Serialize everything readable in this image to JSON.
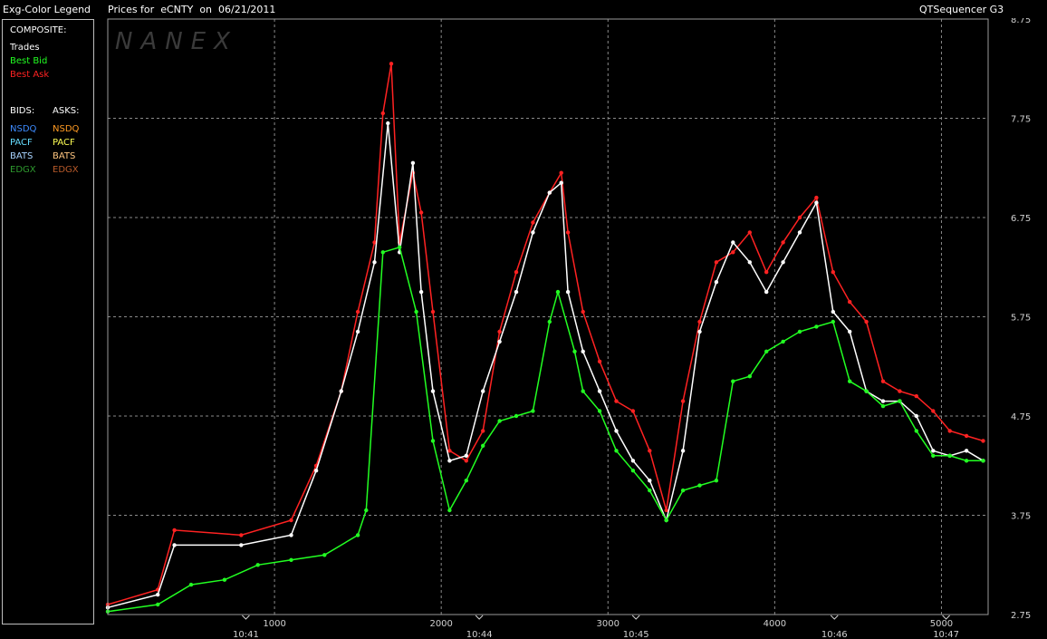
{
  "header": {
    "legend_title": "Exg-Color Legend",
    "chart_title_prefix": "Prices for",
    "symbol": "eCNTY",
    "date_prefix": "on",
    "date": "06/21/2011",
    "app_name": "QTSequencer G3"
  },
  "legend": {
    "composite_heading": "COMPOSITE:",
    "composite_items": [
      {
        "label": "Trades",
        "color": "#ffffff"
      },
      {
        "label": "Best Bid",
        "color": "#22ff22"
      },
      {
        "label": "Best Ask",
        "color": "#ff2222"
      }
    ],
    "bids_heading": "BIDS:",
    "asks_heading": "ASKS:",
    "bids": [
      {
        "label": "NSDQ",
        "color": "#3d8bff"
      },
      {
        "label": "PACF",
        "color": "#66ddff"
      },
      {
        "label": "BATS",
        "color": "#a9d4ff"
      },
      {
        "label": "EDGX",
        "color": "#2e9a2e"
      }
    ],
    "asks": [
      {
        "label": "NSDQ",
        "color": "#ff9a22"
      },
      {
        "label": "PACF",
        "color": "#ffff55"
      },
      {
        "label": "BATS",
        "color": "#ffc680"
      },
      {
        "label": "EDGX",
        "color": "#b85a2a"
      }
    ]
  },
  "watermark": "NANEX",
  "chart_data": {
    "type": "line",
    "y_ticks": [
      "8.75",
      "7.75",
      "6.75",
      "5.75",
      "4.75",
      "3.75",
      "2.75"
    ],
    "ylim": [
      2.75,
      8.75
    ],
    "xlim": [
      0,
      5280
    ],
    "x_seq_ticks": [
      {
        "x": 1000,
        "label": "1000"
      },
      {
        "x": 2000,
        "label": "2000"
      },
      {
        "x": 3000,
        "label": "3000"
      },
      {
        "x": 4000,
        "label": "4000"
      },
      {
        "x": 5000,
        "label": "5000"
      }
    ],
    "x_time_ticks": [
      {
        "x": 828,
        "label": "10:41"
      },
      {
        "x": 2228,
        "label": "10:44"
      },
      {
        "x": 3168,
        "label": "10:45"
      },
      {
        "x": 4358,
        "label": "10:46"
      },
      {
        "x": 5028,
        "label": "10:47"
      }
    ],
    "grid": true,
    "series": [
      {
        "name": "Best Ask",
        "color": "#ff2222",
        "points": [
          [
            0,
            2.85
          ],
          [
            300,
            3.0
          ],
          [
            400,
            3.6
          ],
          [
            800,
            3.55
          ],
          [
            1100,
            3.7
          ],
          [
            1250,
            4.25
          ],
          [
            1400,
            5.0
          ],
          [
            1500,
            5.8
          ],
          [
            1600,
            6.5
          ],
          [
            1650,
            7.8
          ],
          [
            1700,
            8.3
          ],
          [
            1750,
            6.5
          ],
          [
            1830,
            7.2
          ],
          [
            1880,
            6.8
          ],
          [
            1950,
            5.8
          ],
          [
            2050,
            4.4
          ],
          [
            2150,
            4.3
          ],
          [
            2250,
            4.6
          ],
          [
            2350,
            5.6
          ],
          [
            2450,
            6.2
          ],
          [
            2550,
            6.7
          ],
          [
            2650,
            7.0
          ],
          [
            2720,
            7.2
          ],
          [
            2760,
            6.6
          ],
          [
            2850,
            5.8
          ],
          [
            2950,
            5.3
          ],
          [
            3050,
            4.9
          ],
          [
            3150,
            4.8
          ],
          [
            3250,
            4.4
          ],
          [
            3350,
            3.8
          ],
          [
            3450,
            4.9
          ],
          [
            3550,
            5.7
          ],
          [
            3650,
            6.3
          ],
          [
            3750,
            6.4
          ],
          [
            3850,
            6.6
          ],
          [
            3950,
            6.2
          ],
          [
            4050,
            6.5
          ],
          [
            4150,
            6.75
          ],
          [
            4250,
            6.95
          ],
          [
            4350,
            6.2
          ],
          [
            4450,
            5.9
          ],
          [
            4550,
            5.7
          ],
          [
            4650,
            5.1
          ],
          [
            4750,
            5.0
          ],
          [
            4850,
            4.95
          ],
          [
            4950,
            4.8
          ],
          [
            5050,
            4.6
          ],
          [
            5150,
            4.55
          ],
          [
            5250,
            4.5
          ]
        ]
      },
      {
        "name": "Trades",
        "color": "#ffffff",
        "points": [
          [
            0,
            2.82
          ],
          [
            300,
            2.95
          ],
          [
            400,
            3.45
          ],
          [
            800,
            3.45
          ],
          [
            1100,
            3.55
          ],
          [
            1250,
            4.2
          ],
          [
            1400,
            5.0
          ],
          [
            1500,
            5.6
          ],
          [
            1600,
            6.3
          ],
          [
            1680,
            7.7
          ],
          [
            1750,
            6.4
          ],
          [
            1830,
            7.3
          ],
          [
            1880,
            6.0
          ],
          [
            1950,
            5.0
          ],
          [
            2050,
            4.3
          ],
          [
            2150,
            4.35
          ],
          [
            2250,
            5.0
          ],
          [
            2350,
            5.5
          ],
          [
            2450,
            6.0
          ],
          [
            2550,
            6.6
          ],
          [
            2650,
            7.0
          ],
          [
            2720,
            7.1
          ],
          [
            2760,
            6.0
          ],
          [
            2850,
            5.4
          ],
          [
            2950,
            5.0
          ],
          [
            3050,
            4.6
          ],
          [
            3150,
            4.3
          ],
          [
            3250,
            4.1
          ],
          [
            3350,
            3.7
          ],
          [
            3450,
            4.4
          ],
          [
            3550,
            5.6
          ],
          [
            3650,
            6.1
          ],
          [
            3750,
            6.5
          ],
          [
            3850,
            6.3
          ],
          [
            3950,
            6.0
          ],
          [
            4050,
            6.3
          ],
          [
            4150,
            6.6
          ],
          [
            4250,
            6.9
          ],
          [
            4350,
            5.8
          ],
          [
            4450,
            5.6
          ],
          [
            4550,
            5.0
          ],
          [
            4650,
            4.9
          ],
          [
            4750,
            4.9
          ],
          [
            4850,
            4.75
          ],
          [
            4950,
            4.4
          ],
          [
            5050,
            4.35
          ],
          [
            5150,
            4.4
          ],
          [
            5250,
            4.3
          ]
        ]
      },
      {
        "name": "Best Bid",
        "color": "#22ff22",
        "points": [
          [
            0,
            2.78
          ],
          [
            300,
            2.85
          ],
          [
            500,
            3.05
          ],
          [
            700,
            3.1
          ],
          [
            900,
            3.25
          ],
          [
            1100,
            3.3
          ],
          [
            1300,
            3.35
          ],
          [
            1500,
            3.55
          ],
          [
            1550,
            3.8
          ],
          [
            1650,
            6.4
          ],
          [
            1750,
            6.45
          ],
          [
            1850,
            5.8
          ],
          [
            1950,
            4.5
          ],
          [
            2050,
            3.8
          ],
          [
            2150,
            4.1
          ],
          [
            2250,
            4.45
          ],
          [
            2350,
            4.7
          ],
          [
            2450,
            4.75
          ],
          [
            2550,
            4.8
          ],
          [
            2650,
            5.7
          ],
          [
            2700,
            6.0
          ],
          [
            2800,
            5.4
          ],
          [
            2850,
            5.0
          ],
          [
            2950,
            4.8
          ],
          [
            3050,
            4.4
          ],
          [
            3150,
            4.2
          ],
          [
            3250,
            4.0
          ],
          [
            3350,
            3.7
          ],
          [
            3450,
            4.0
          ],
          [
            3550,
            4.05
          ],
          [
            3650,
            4.1
          ],
          [
            3750,
            5.1
          ],
          [
            3850,
            5.15
          ],
          [
            3950,
            5.4
          ],
          [
            4050,
            5.5
          ],
          [
            4150,
            5.6
          ],
          [
            4250,
            5.65
          ],
          [
            4350,
            5.7
          ],
          [
            4450,
            5.1
          ],
          [
            4550,
            5.0
          ],
          [
            4650,
            4.85
          ],
          [
            4750,
            4.9
          ],
          [
            4850,
            4.6
          ],
          [
            4950,
            4.35
          ],
          [
            5050,
            4.35
          ],
          [
            5150,
            4.3
          ],
          [
            5250,
            4.3
          ]
        ]
      }
    ]
  }
}
